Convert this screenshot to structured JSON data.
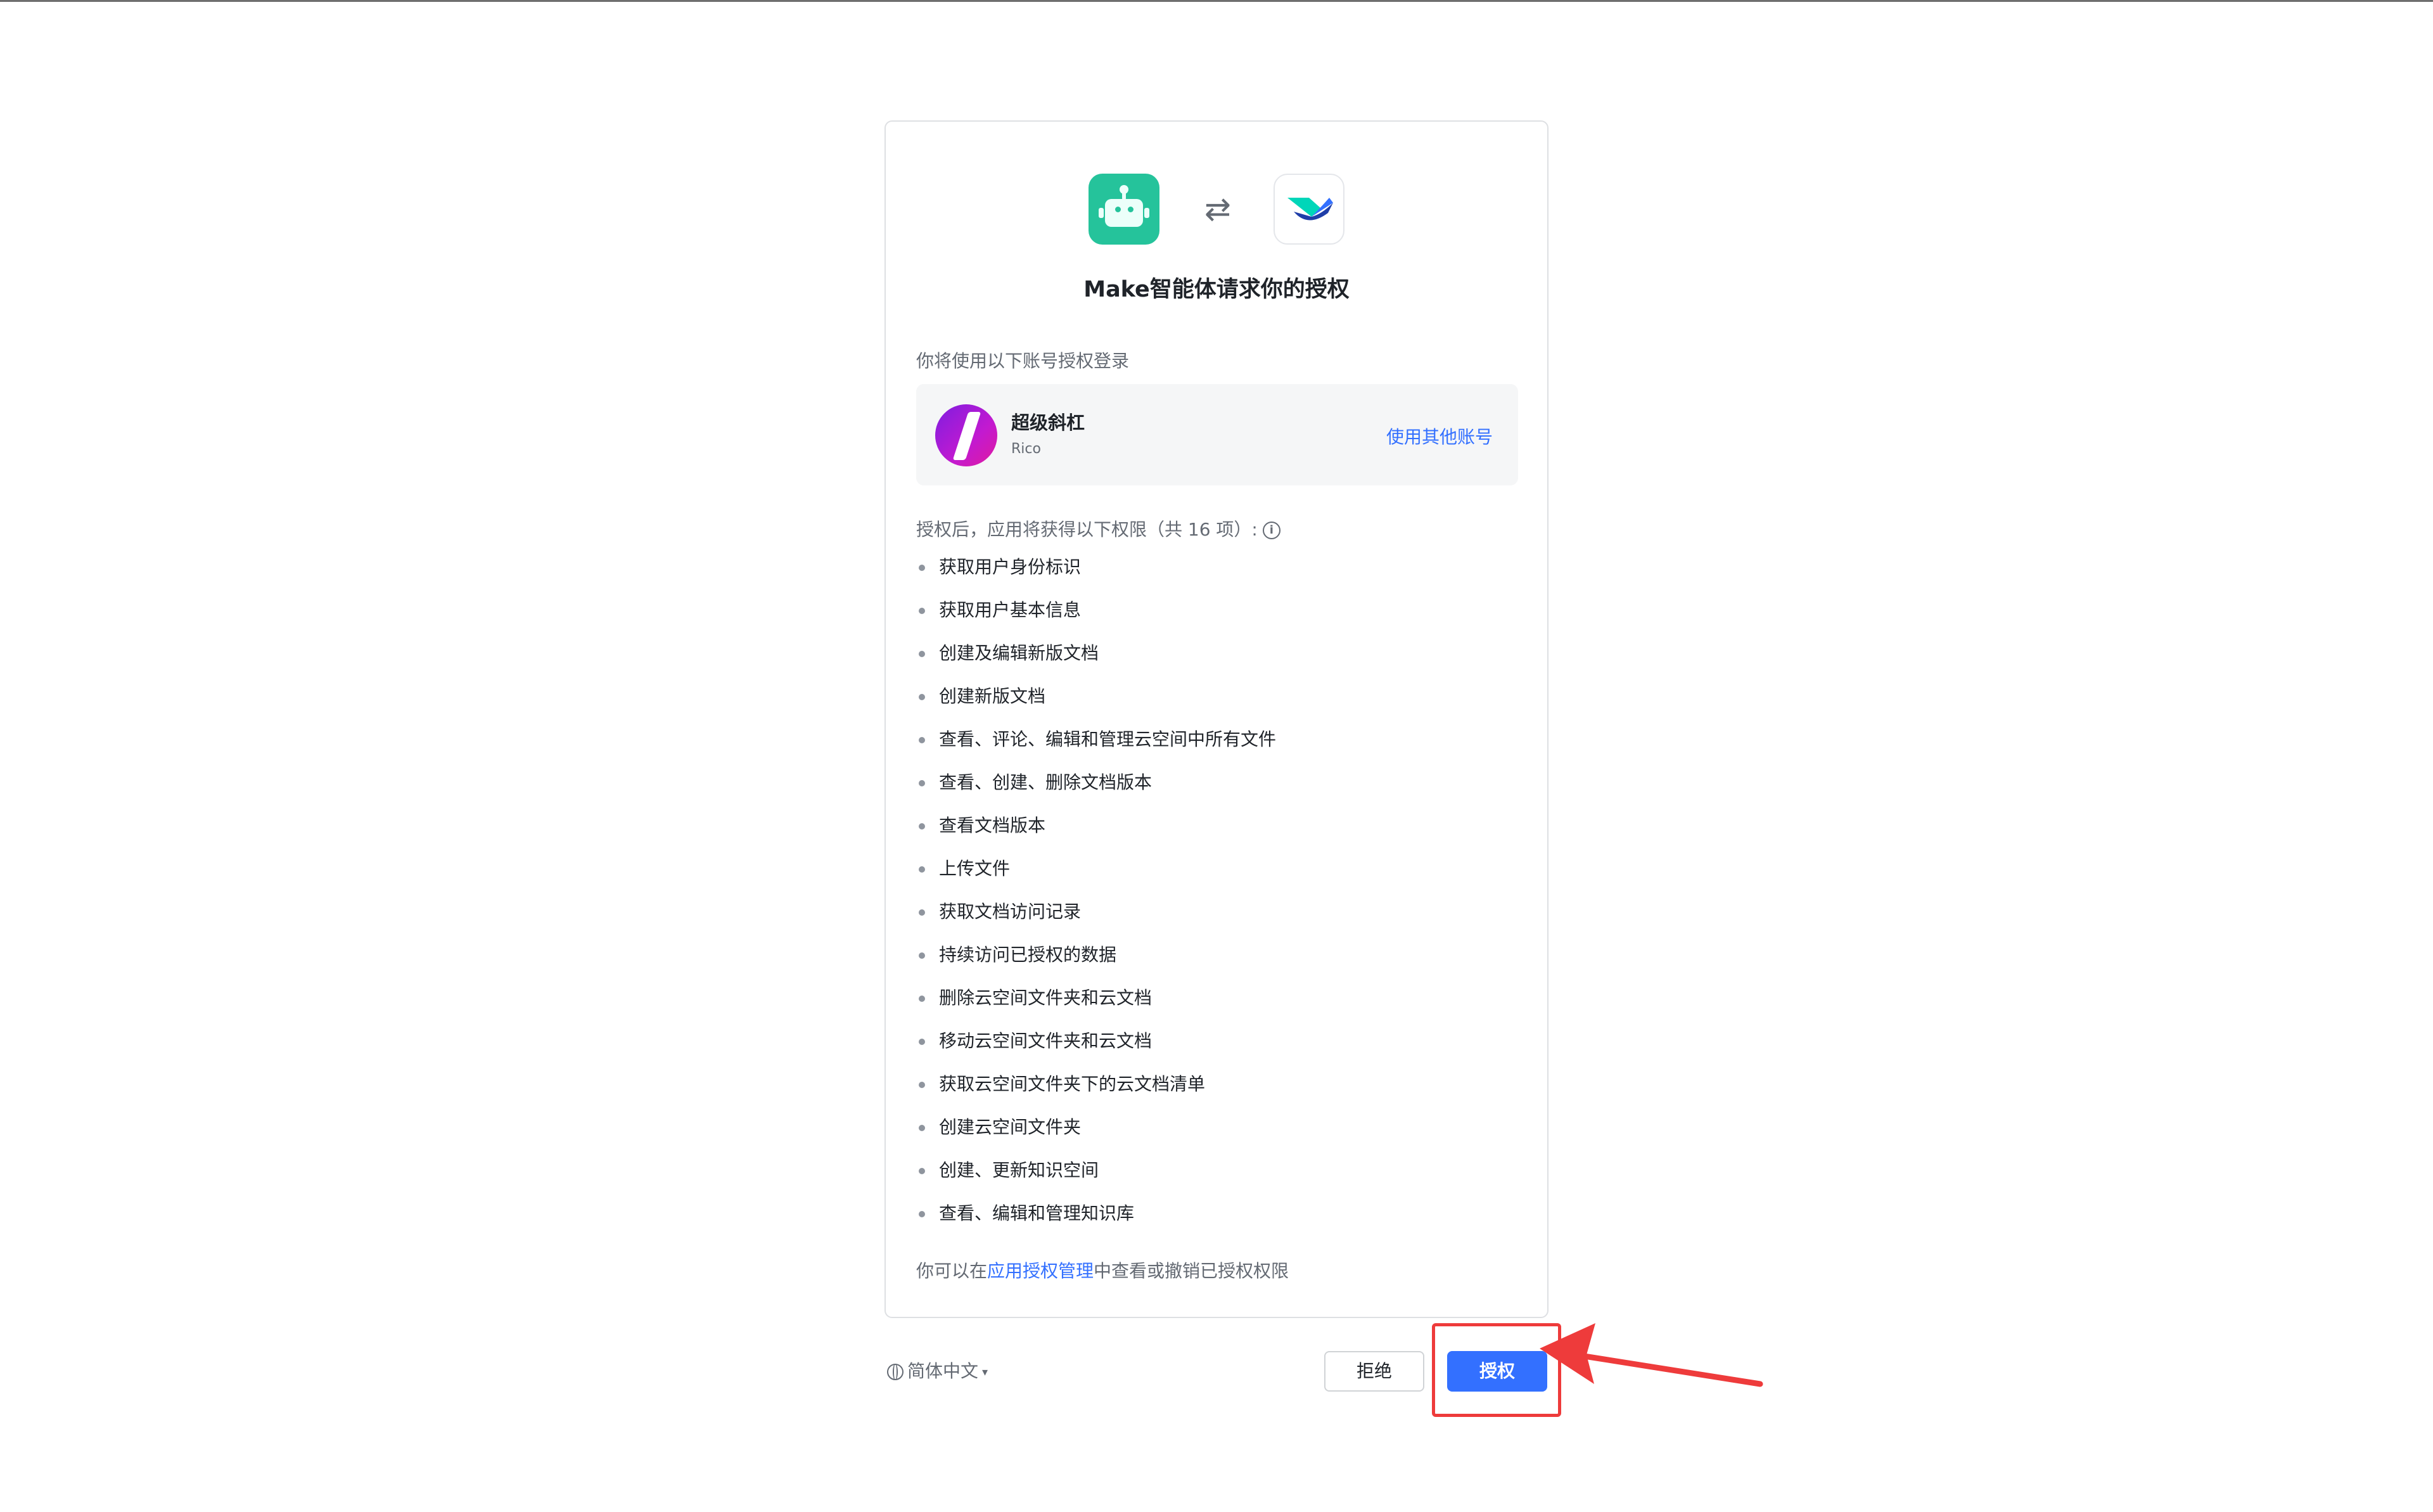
{
  "dialog": {
    "title": "Make智能体请求你的授权",
    "swap_glyph": "⇄",
    "account_section_label": "你将使用以下账号授权登录",
    "account": {
      "name": "超级斜杠",
      "sub": "Rico",
      "switch_label": "使用其他账号"
    },
    "permissions_label": "授权后，应用将获得以下权限（共 16 项）:",
    "permissions": [
      "获取用户身份标识",
      "获取用户基本信息",
      "创建及编辑新版文档",
      "创建新版文档",
      "查看、评论、编辑和管理云空间中所有文件",
      "查看、创建、删除文档版本",
      "查看文档版本",
      "上传文件",
      "获取文档访问记录",
      "持续访问已授权的数据",
      "删除云空间文件夹和云文档",
      "移动云空间文件夹和云文档",
      "获取云空间文件夹下的云文档清单",
      "创建云空间文件夹",
      "创建、更新知识空间",
      "查看、编辑和管理知识库"
    ],
    "footer_prefix": "你可以在",
    "footer_link": "应用授权管理",
    "footer_suffix": "中查看或撤销已授权权限"
  },
  "footer": {
    "language": "简体中文",
    "reject_label": "拒绝",
    "authorize_label": "授权"
  },
  "colors": {
    "accent": "#3370ff",
    "robot_app": "#25c39b",
    "annotation": "#ee3b3b"
  },
  "icons": [
    "robot-app-icon",
    "swap-icon",
    "lark-app-icon",
    "info-icon",
    "globe-icon",
    "caret-down-icon"
  ]
}
